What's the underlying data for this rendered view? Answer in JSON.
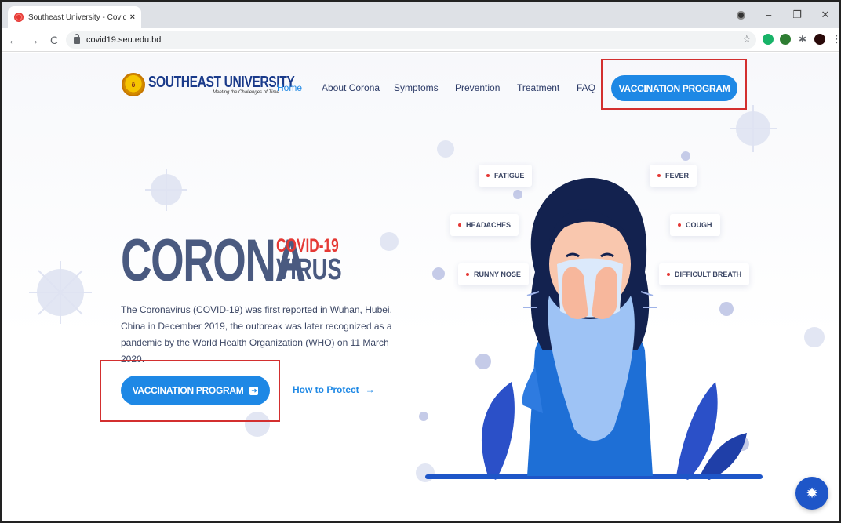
{
  "browser": {
    "tab_title": "Southeast University - Covid Awa",
    "tab_close": "×",
    "url": "covid19.seu.edu.bd",
    "win_minimize": "−",
    "win_restore": "❐",
    "win_close": "✕",
    "nav_back": "←",
    "nav_forward": "→",
    "nav_reload": "C",
    "bookmark_star": "☆",
    "more_menu": "⋮"
  },
  "site": {
    "logo_name": "SOUTHEAST UNIVERSITY",
    "logo_tagline": "Meeting the Challenges of Time",
    "nav": [
      "Home",
      "About Corona",
      "Symptoms",
      "Prevention",
      "Treatment",
      "FAQ"
    ],
    "header_button": "VACCINATION PROGRAM"
  },
  "hero": {
    "title_main": "CORONA",
    "title_sup": "COVID-19",
    "title_sub": "VIRUS",
    "description": "The Coronavirus (COVID-19) was first reported in Wuhan, Hubei, China in December 2019, the outbreak was later recognized as a pandemic by the World Health Organization (WHO) on 11 March 2020.",
    "primary_button": "VACCINATION PROGRAM",
    "secondary_link": "How to Protect",
    "secondary_arrow": "→"
  },
  "symptoms": [
    "FATIGUE",
    "FEVER",
    "HEADACHES",
    "COUGH",
    "RUNNY NOSE",
    "DIFFICULT BREATH"
  ],
  "colors": {
    "accent": "#1e88e5",
    "heading": "#4a5a80",
    "highlight_box": "#d32f2f",
    "covid_red": "#e53935"
  },
  "icons": {
    "fab": "virus-icon"
  }
}
